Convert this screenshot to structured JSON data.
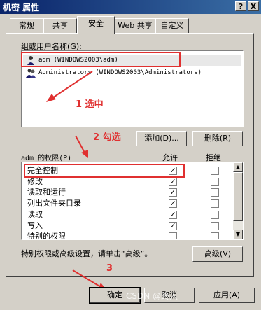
{
  "window": {
    "title": "机密 属性",
    "help_btn": "?",
    "close_btn": "X"
  },
  "tabs": [
    "常规",
    "共享",
    "安全",
    "Web 共享",
    "自定义"
  ],
  "group_label": "组或用户名称(G):",
  "users": [
    {
      "name": "adm (WINDOWS2003\\adm)",
      "icon": "user-icon"
    },
    {
      "name": "Administrators (WINDOWS2003\\Administrators)",
      "icon": "group-icon"
    }
  ],
  "add_button": "添加(D)...",
  "remove_button": "删除(R)",
  "perm_label": "adm 的权限(P)",
  "allow_header": "允许",
  "deny_header": "拒绝",
  "permissions": [
    {
      "name": "完全控制",
      "allow": true,
      "deny": false
    },
    {
      "name": "修改",
      "allow": true,
      "deny": false
    },
    {
      "name": "读取和运行",
      "allow": true,
      "deny": false
    },
    {
      "name": "列出文件夹目录",
      "allow": true,
      "deny": false
    },
    {
      "name": "读取",
      "allow": true,
      "deny": false
    },
    {
      "name": "写入",
      "allow": true,
      "deny": false
    },
    {
      "name": "特别的权限",
      "allow": false,
      "deny": false
    }
  ],
  "special_text": "特别权限或高级设置，请单击“高级”。",
  "advanced_button": "高级(V)",
  "ok_button": "确定",
  "cancel_button": "取消",
  "apply_button": "应用(A)",
  "annotations": {
    "step1": "1  选中",
    "step2": "2 勾选",
    "step3": "3"
  },
  "watermark": "CSDN @终人",
  "colors": {
    "annotation": "#e03030",
    "titlebar": "#0a246a"
  }
}
